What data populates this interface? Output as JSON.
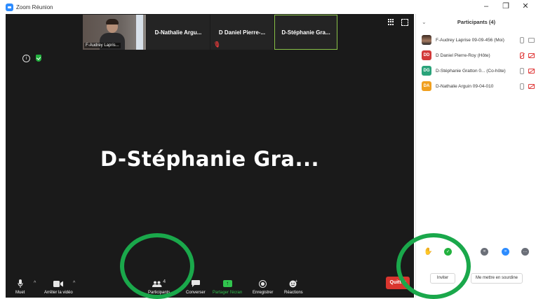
{
  "window": {
    "title": "Zoom Réunion",
    "controls": {
      "minimize": "–",
      "restore": "❐",
      "close": "✕"
    }
  },
  "thumbnails": [
    {
      "name": "F-Audrey Lapris...",
      "video": true
    },
    {
      "name": "D-Nathalie Argu...",
      "video": false
    },
    {
      "name": "D Daniel Pierre-...",
      "video": false,
      "muted": true
    },
    {
      "name": "D-Stéphanie Gra...",
      "video": false,
      "active": true
    }
  ],
  "speaker": {
    "name": "D-Stéphanie  Gra..."
  },
  "toolbar": {
    "mute_label": "Muet",
    "video_label": "Arrêter la vidéo",
    "participants_label": "Participants",
    "participants_count": "4",
    "chat_label": "Converser",
    "share_label": "Partager l'écran",
    "record_label": "Enregistrer",
    "reactions_label": "Réactions",
    "leave_label": "Quitter"
  },
  "participants_panel": {
    "title": "Participants (4)",
    "people": [
      {
        "initials": "",
        "name": "F-Audrey Laprise 09-09-456 (Moi)",
        "color": "#8a6a55",
        "muted": false,
        "video_off": false
      },
      {
        "initials": "DD",
        "name": "D Daniel Pierre-Roy (Hôte)",
        "color": "#d23a3a",
        "muted": true,
        "video_off": true
      },
      {
        "initials": "DG",
        "name": "D-Stéphanie Gratton 0... (Co-hôte)",
        "color": "#2aa37a",
        "muted": false,
        "video_off": true
      },
      {
        "initials": "DA",
        "name": "D-Nathalie Arguin 09-04-010",
        "color": "#f0a020",
        "muted": false,
        "video_off": true
      }
    ],
    "invite_label": "Inviter",
    "mute_all_label": "Me mettre en sourdine"
  },
  "colors": {
    "stage": "#1a1a1a",
    "accent_green": "#31c44e",
    "annotation_ring": "#1aa84b",
    "leave_red": "#d9352e",
    "zoom_blue": "#2d8cff"
  }
}
